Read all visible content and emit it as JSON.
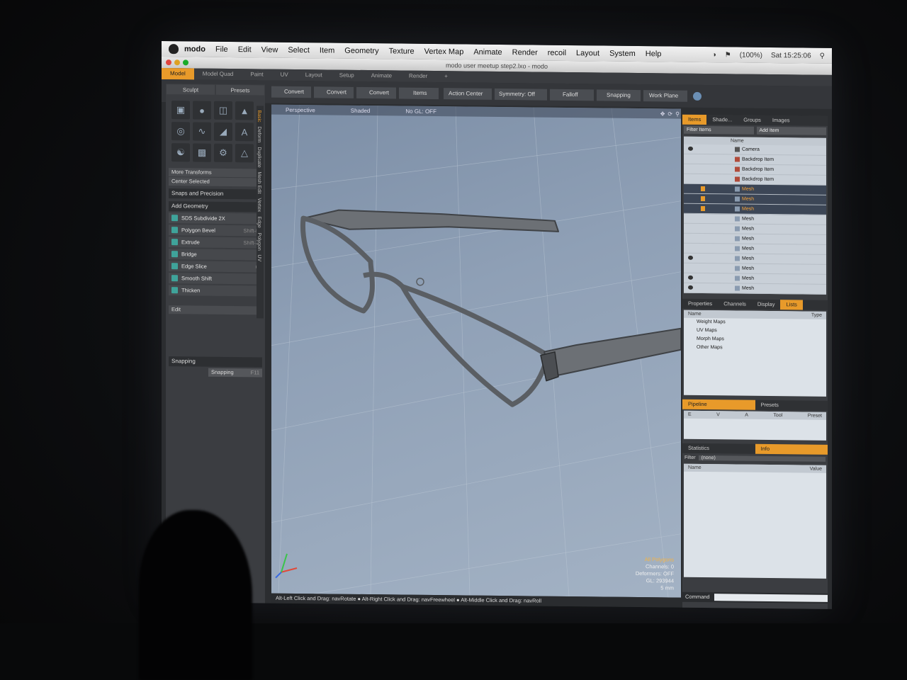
{
  "menubar": {
    "app_name": "modo",
    "items": [
      "File",
      "Edit",
      "View",
      "Select",
      "Item",
      "Geometry",
      "Texture",
      "Vertex Map",
      "Animate",
      "Render",
      "recoil",
      "Layout",
      "System",
      "Help"
    ],
    "battery": "(100%)",
    "clock": "Sat 15:25:06"
  },
  "window_title": "modo user meetup step2.lxo - modo",
  "layout_tabs": [
    "Model",
    "Model Quad",
    "Paint",
    "UV",
    "Layout",
    "Setup",
    "Animate",
    "Render"
  ],
  "toolbar": {
    "buttons": [
      "Convert",
      "Convert",
      "Convert",
      "Items"
    ],
    "action_center": "Action Center",
    "symmetry": "Symmetry: Off",
    "falloff": "Falloff",
    "snapping": "Snapping",
    "work_plane": "Work Plane"
  },
  "left_panel": {
    "tabs": [
      "Sculpt",
      "Presets"
    ],
    "more_transforms": "More Transforms",
    "center_selected": "Center Selected",
    "snaps": "Snaps and Precision",
    "add_geometry": "Add Geometry",
    "items": [
      {
        "label": "SDS Subdivide 2X",
        "shortcut": ""
      },
      {
        "label": "Polygon Bevel",
        "shortcut": "Shift-B"
      },
      {
        "label": "Extrude",
        "shortcut": "Shift-X"
      },
      {
        "label": "Bridge",
        "shortcut": ""
      },
      {
        "label": "Edge Slice",
        "shortcut": "C"
      },
      {
        "label": "Smooth Shift",
        "shortcut": ""
      },
      {
        "label": "Thicken",
        "shortcut": ""
      }
    ],
    "edit": "Edit",
    "snapping_section": "Snapping",
    "snapping_btn": "Snapping",
    "snapping_key": "F11",
    "vertical_tabs": [
      "Basic",
      "Deform",
      "Duplicate",
      "Mesh Edit",
      "Vertex",
      "Edge",
      "Polygon",
      "UV"
    ]
  },
  "viewport": {
    "view": "Perspective",
    "shading": "Shaded",
    "gl": "No GL: OFF",
    "stats": {
      "all_polygons": "All Polygons",
      "channels": "Channels: 0",
      "deformers": "Deformers: OFF",
      "gl": "GL: 293944",
      "unit": "5 mm"
    },
    "status": "Alt-Left Click and Drag: navRotate ● Alt-Right Click and Drag: navFreewheel ● Alt-Middle Click and Drag: navRoll"
  },
  "items_panel": {
    "tabs": [
      "Items",
      "Shade...",
      "Groups",
      "Images"
    ],
    "filter": "Filter Items",
    "add_item": "Add Item",
    "col_name": "Name",
    "rows": [
      {
        "label": "Camera",
        "type": "cam",
        "sel": false,
        "eye": true,
        "lock": false
      },
      {
        "label": "Backdrop Item",
        "type": "bd",
        "sel": false,
        "eye": false,
        "lock": false
      },
      {
        "label": "Backdrop Item",
        "type": "bd",
        "sel": false,
        "eye": false,
        "lock": false
      },
      {
        "label": "Backdrop Item",
        "type": "bd",
        "sel": false,
        "eye": false,
        "lock": false
      },
      {
        "label": "Mesh",
        "type": "mesh",
        "sel": true,
        "eye": false,
        "lock": true
      },
      {
        "label": "Mesh",
        "type": "mesh",
        "sel": true,
        "eye": false,
        "lock": true
      },
      {
        "label": "Mesh",
        "type": "mesh",
        "sel": true,
        "eye": false,
        "lock": true
      },
      {
        "label": "Mesh",
        "type": "mesh",
        "sel": false,
        "eye": false,
        "lock": false
      },
      {
        "label": "Mesh",
        "type": "mesh",
        "sel": false,
        "eye": false,
        "lock": false
      },
      {
        "label": "Mesh",
        "type": "mesh",
        "sel": false,
        "eye": false,
        "lock": false
      },
      {
        "label": "Mesh",
        "type": "mesh",
        "sel": false,
        "eye": false,
        "lock": false
      },
      {
        "label": "Mesh",
        "type": "mesh",
        "sel": false,
        "eye": true,
        "lock": false
      },
      {
        "label": "Mesh",
        "type": "mesh",
        "sel": false,
        "eye": false,
        "lock": false
      },
      {
        "label": "Mesh",
        "type": "mesh",
        "sel": false,
        "eye": true,
        "lock": false
      },
      {
        "label": "Mesh",
        "type": "mesh",
        "sel": false,
        "eye": true,
        "lock": false
      }
    ]
  },
  "props_panel": {
    "tabs": [
      "Properties",
      "Channels",
      "Display",
      "Lists"
    ],
    "col_name": "Name",
    "col_type": "Type",
    "tree": [
      "Weight Maps",
      "UV Maps",
      "Morph Maps",
      "Other Maps"
    ]
  },
  "pipeline_panel": {
    "tabs": [
      "Pipeline",
      "Presets"
    ],
    "cols": [
      "E",
      "V",
      "A",
      "Tool",
      "Preset"
    ]
  },
  "stats_panel": {
    "tabs": [
      "Statistics",
      "Info"
    ],
    "filter_label": "Filter",
    "filter_value": "(none)",
    "col_name": "Name",
    "col_value": "Value"
  },
  "command": "Command"
}
